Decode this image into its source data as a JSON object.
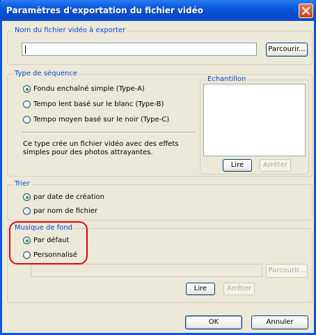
{
  "window": {
    "title": "Paramètres d'exportation du fichier vidéo",
    "close_icon": "close-icon"
  },
  "filename": {
    "group_label": "Nom du fichier vidéo à exporter",
    "value": "",
    "browse_label": "Parcourir..."
  },
  "sequence": {
    "group_label": "Type de séquence",
    "options": [
      {
        "label": "Fondu enchaîné simple (Type-A)",
        "selected": true
      },
      {
        "label": "Tempo lent basé sur le blanc (Type-B)",
        "selected": false
      },
      {
        "label": "Tempo moyen basé sur le noir (Type-C)",
        "selected": false
      }
    ],
    "description": "Ce type crée un fichier vidéo avec des effets\nsimples pour des photos attrayantes.",
    "sample": {
      "label": "Echantillon",
      "play_label": "Lire",
      "stop_label": "Arrêter"
    }
  },
  "sort": {
    "group_label": "Trier",
    "options": [
      {
        "label": "par date de création",
        "selected": true
      },
      {
        "label": "par nom de fichier",
        "selected": false
      }
    ]
  },
  "music": {
    "group_label": "Musique de fond",
    "options": [
      {
        "label": "Par défaut",
        "selected": true
      },
      {
        "label": "Personnalisé",
        "selected": false
      }
    ],
    "path_value": "",
    "browse_label": "Parcourir...",
    "play_label": "Lire",
    "stop_label": "Arrêter"
  },
  "footer": {
    "ok_label": "OK",
    "cancel_label": "Annuler"
  },
  "colors": {
    "accent": "#0046d5",
    "highlight": "#e8000a",
    "selected_radio": "#21a121"
  }
}
